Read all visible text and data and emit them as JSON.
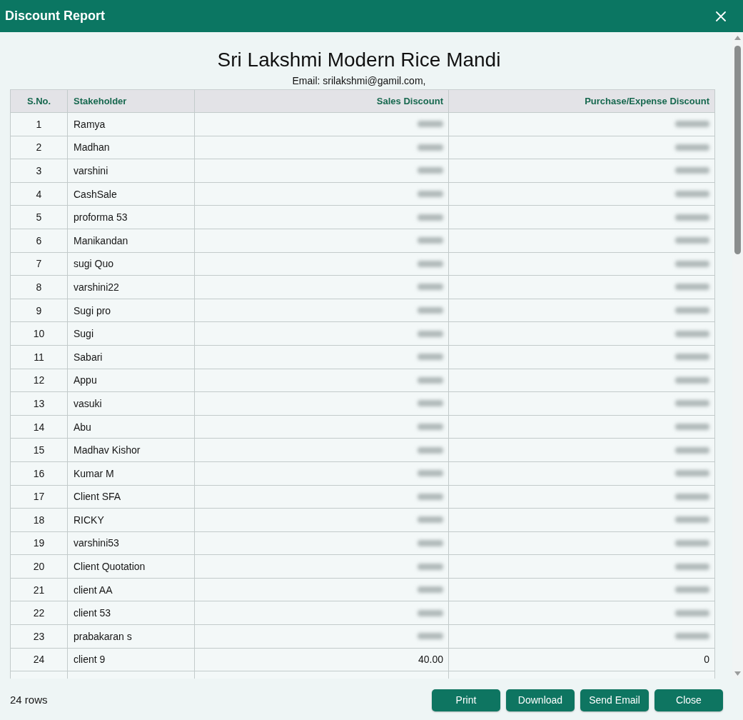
{
  "window": {
    "title": "Discount Report"
  },
  "report": {
    "company": "Sri Lakshmi Modern Rice Mandi",
    "email_line": "Email: srilakshmi@gamil.com,"
  },
  "table": {
    "columns": [
      "S.No.",
      "Stakeholder",
      "Sales Discount",
      "Purchase/Expense Discount"
    ],
    "rows": [
      {
        "sno": "1",
        "stakeholder": "Ramya",
        "blurred": true
      },
      {
        "sno": "2",
        "stakeholder": "Madhan",
        "blurred": true
      },
      {
        "sno": "3",
        "stakeholder": "varshini",
        "blurred": true
      },
      {
        "sno": "4",
        "stakeholder": "CashSale",
        "blurred": true
      },
      {
        "sno": "5",
        "stakeholder": "proforma 53",
        "blurred": true
      },
      {
        "sno": "6",
        "stakeholder": "Manikandan",
        "blurred": true
      },
      {
        "sno": "7",
        "stakeholder": "sugi Quo",
        "blurred": true
      },
      {
        "sno": "8",
        "stakeholder": "varshini22",
        "blurred": true
      },
      {
        "sno": "9",
        "stakeholder": "Sugi pro",
        "blurred": true
      },
      {
        "sno": "10",
        "stakeholder": "Sugi",
        "blurred": true
      },
      {
        "sno": "11",
        "stakeholder": "Sabari",
        "blurred": true
      },
      {
        "sno": "12",
        "stakeholder": "Appu",
        "blurred": true
      },
      {
        "sno": "13",
        "stakeholder": "vasuki",
        "blurred": true
      },
      {
        "sno": "14",
        "stakeholder": "Abu",
        "blurred": true
      },
      {
        "sno": "15",
        "stakeholder": "Madhav Kishor",
        "blurred": true
      },
      {
        "sno": "16",
        "stakeholder": "Kumar M",
        "blurred": true
      },
      {
        "sno": "17",
        "stakeholder": "Client SFA",
        "blurred": true
      },
      {
        "sno": "18",
        "stakeholder": "RICKY",
        "blurred": true
      },
      {
        "sno": "19",
        "stakeholder": "varshini53",
        "blurred": true
      },
      {
        "sno": "20",
        "stakeholder": "Client Quotation",
        "blurred": true
      },
      {
        "sno": "21",
        "stakeholder": "client AA",
        "blurred": true
      },
      {
        "sno": "22",
        "stakeholder": "client 53",
        "blurred": true
      },
      {
        "sno": "23",
        "stakeholder": "prabakaran s",
        "blurred": true
      },
      {
        "sno": "24",
        "stakeholder": "client 9",
        "blurred": false,
        "sales_discount": "40.00",
        "purchase_expense_discount": "0"
      }
    ]
  },
  "status_bar": {
    "row_count": "24 rows"
  },
  "buttons": [
    "Print",
    "Download",
    "Send Email",
    "Close"
  ]
}
